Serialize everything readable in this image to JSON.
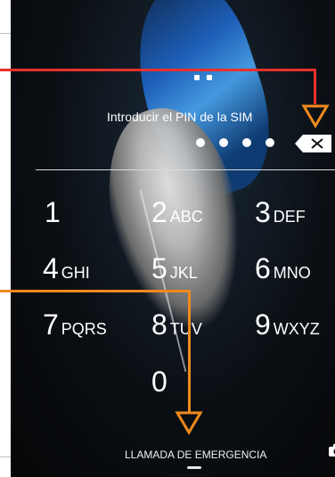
{
  "sim_prompt": "Introducir el PIN de la SIM",
  "pin_entered_digits": 4,
  "keypad": {
    "keys": [
      {
        "number": "1",
        "letters": ""
      },
      {
        "number": "2",
        "letters": "ABC"
      },
      {
        "number": "3",
        "letters": "DEF"
      },
      {
        "number": "4",
        "letters": "GHI"
      },
      {
        "number": "5",
        "letters": "JKL"
      },
      {
        "number": "6",
        "letters": "MNO"
      },
      {
        "number": "7",
        "letters": "PQRS"
      },
      {
        "number": "8",
        "letters": "TUV"
      },
      {
        "number": "9",
        "letters": "WXYZ"
      },
      {
        "number": "0",
        "letters": ""
      }
    ]
  },
  "emergency_call": "LLAMADA DE EMERGENCIA",
  "icons": {
    "backspace": "backspace-icon",
    "camera": "camera-icon",
    "annotation_arrow_red": "triangle-down-icon",
    "annotation_arrow_orange": "triangle-down-icon"
  },
  "colors": {
    "annotation_red": "#e8312a",
    "annotation_orange": "#f08a1e",
    "text": "#ffffff"
  }
}
